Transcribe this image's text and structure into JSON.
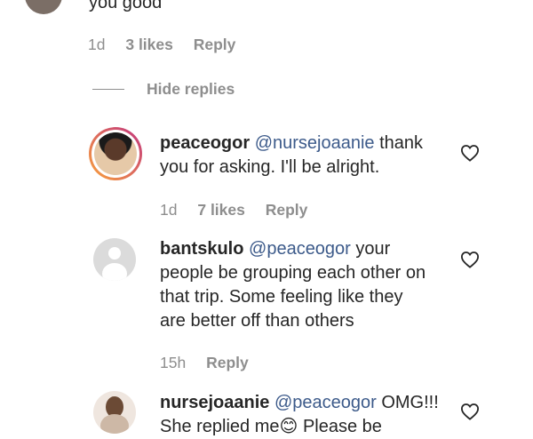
{
  "top_comment": {
    "text_fragment": "you good",
    "time": "1d",
    "likes": "3 likes",
    "reply": "Reply"
  },
  "hide_replies_label": "Hide replies",
  "replies": [
    {
      "username": "peaceogor",
      "mention": "@nursejoaanie",
      "text_line1": "thank",
      "text_line2": "you for asking. I'll be alright.",
      "time": "1d",
      "likes": "7 likes",
      "reply": "Reply"
    },
    {
      "username": "bantskulo",
      "mention": "@peaceogor",
      "text_line1": "your",
      "text_line2": "people be grouping each other on",
      "text_line3": "that trip. Some feeling like they",
      "text_line4": "are better off than others",
      "time": "15h",
      "reply": "Reply"
    },
    {
      "username": "nursejoaanie",
      "mention": "@peaceogor",
      "text_line1": "OMG!!!",
      "text_line2_a": "She replied me",
      "text_line2_emoji": "😊",
      "text_line2_b": " Please be"
    }
  ],
  "colors": {
    "text": "#262626",
    "secondary": "#8e8e8e",
    "mention": "#3c5a8a",
    "story_ring_start": "#f9a23c",
    "story_ring_end": "#c1357f"
  },
  "icons": {
    "like": "heart-outline-icon",
    "default_avatar": "person-placeholder-icon"
  }
}
